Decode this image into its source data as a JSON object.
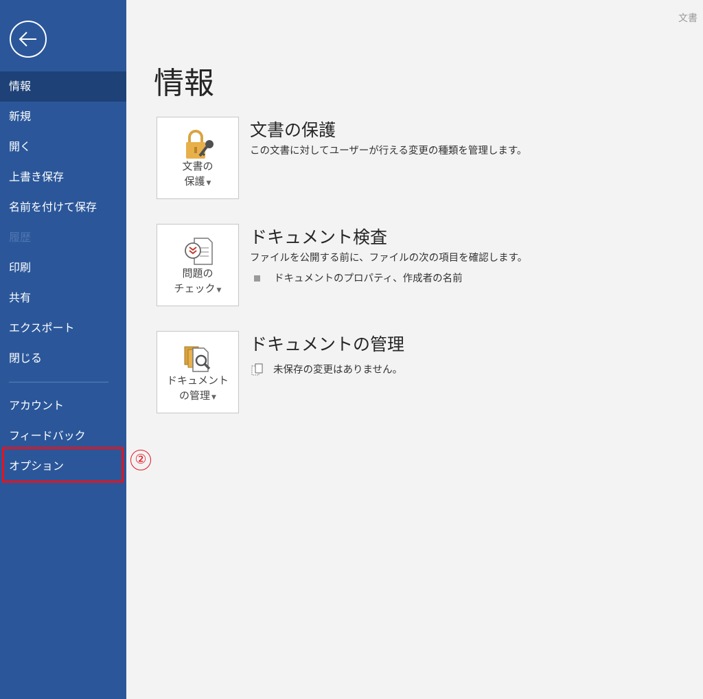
{
  "corner_label": "文書",
  "sidebar": {
    "back_icon": "back-arrow-icon",
    "items": [
      {
        "label": "情報",
        "state": "active"
      },
      {
        "label": "新規"
      },
      {
        "label": "開く"
      },
      {
        "label": "上書き保存"
      },
      {
        "label": "名前を付けて保存"
      },
      {
        "label": "履歴",
        "state": "disabled"
      },
      {
        "label": "印刷"
      },
      {
        "label": "共有"
      },
      {
        "label": "エクスポート"
      },
      {
        "label": "閉じる"
      }
    ],
    "bottom_items": [
      {
        "label": "アカウント"
      },
      {
        "label": "フィードバック"
      },
      {
        "label": "オプション"
      }
    ]
  },
  "annotation": {
    "step": "②",
    "color": "#e4141e"
  },
  "main": {
    "title": "情報",
    "sections": [
      {
        "tile_icon": "lock-key-icon",
        "tile_line1": "文書の",
        "tile_line2": "保護",
        "title": "文書の保護",
        "description": "この文書に対してユーザーが行える変更の種類を管理します。"
      },
      {
        "tile_icon": "document-check-icon",
        "tile_line1": "問題の",
        "tile_line2": "チェック",
        "title": "ドキュメント検査",
        "description": "ファイルを公開する前に、ファイルの次の項目を確認します。",
        "bullet": "ドキュメントのプロパティ、作成者の名前"
      },
      {
        "tile_icon": "manage-document-icon",
        "tile_line1": "ドキュメント",
        "tile_line2": "の管理",
        "title": "ドキュメントの管理",
        "status": "未保存の変更はありません。"
      }
    ]
  },
  "colors": {
    "sidebar_bg": "#2b579a",
    "sidebar_active": "#1e4278",
    "main_bg": "#f3f3f3"
  }
}
